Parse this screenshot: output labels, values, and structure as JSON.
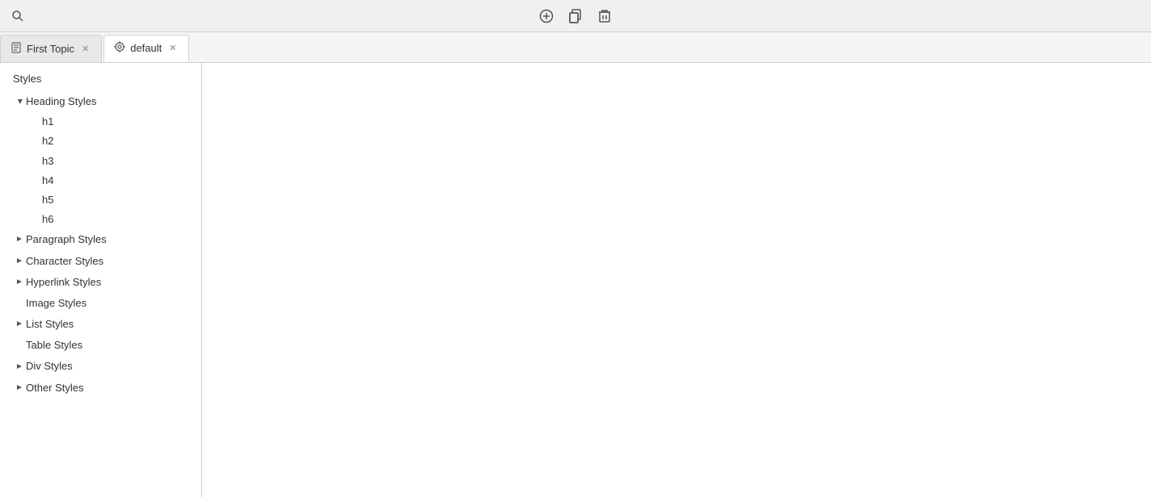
{
  "toolbar": {
    "search_icon": "🔍",
    "add_icon": "+",
    "copy_icon": "⧉",
    "delete_icon": "🗑"
  },
  "tabs": [
    {
      "id": "first-topic",
      "label": "First Topic",
      "icon": "📄",
      "active": false,
      "closeable": true
    },
    {
      "id": "default",
      "label": "default",
      "icon": "🎨",
      "active": true,
      "closeable": true
    }
  ],
  "sidebar": {
    "title": "Styles",
    "tree": [
      {
        "id": "heading-styles",
        "label": "Heading Styles",
        "expanded": true,
        "hasArrow": true,
        "children": [
          "h1",
          "h2",
          "h3",
          "h4",
          "h5",
          "h6"
        ]
      },
      {
        "id": "paragraph-styles",
        "label": "Paragraph Styles",
        "expanded": false,
        "hasArrow": true,
        "children": []
      },
      {
        "id": "character-styles",
        "label": "Character Styles",
        "expanded": false,
        "hasArrow": true,
        "children": []
      },
      {
        "id": "hyperlink-styles",
        "label": "Hyperlink Styles",
        "expanded": false,
        "hasArrow": true,
        "children": []
      },
      {
        "id": "image-styles",
        "label": "Image Styles",
        "expanded": false,
        "hasArrow": false,
        "children": []
      },
      {
        "id": "list-styles",
        "label": "List Styles",
        "expanded": false,
        "hasArrow": true,
        "children": []
      },
      {
        "id": "table-styles",
        "label": "Table Styles",
        "expanded": false,
        "hasArrow": false,
        "children": []
      },
      {
        "id": "div-styles",
        "label": "Div Styles",
        "expanded": false,
        "hasArrow": true,
        "children": []
      },
      {
        "id": "other-styles",
        "label": "Other Styles",
        "expanded": false,
        "hasArrow": true,
        "children": []
      }
    ]
  }
}
